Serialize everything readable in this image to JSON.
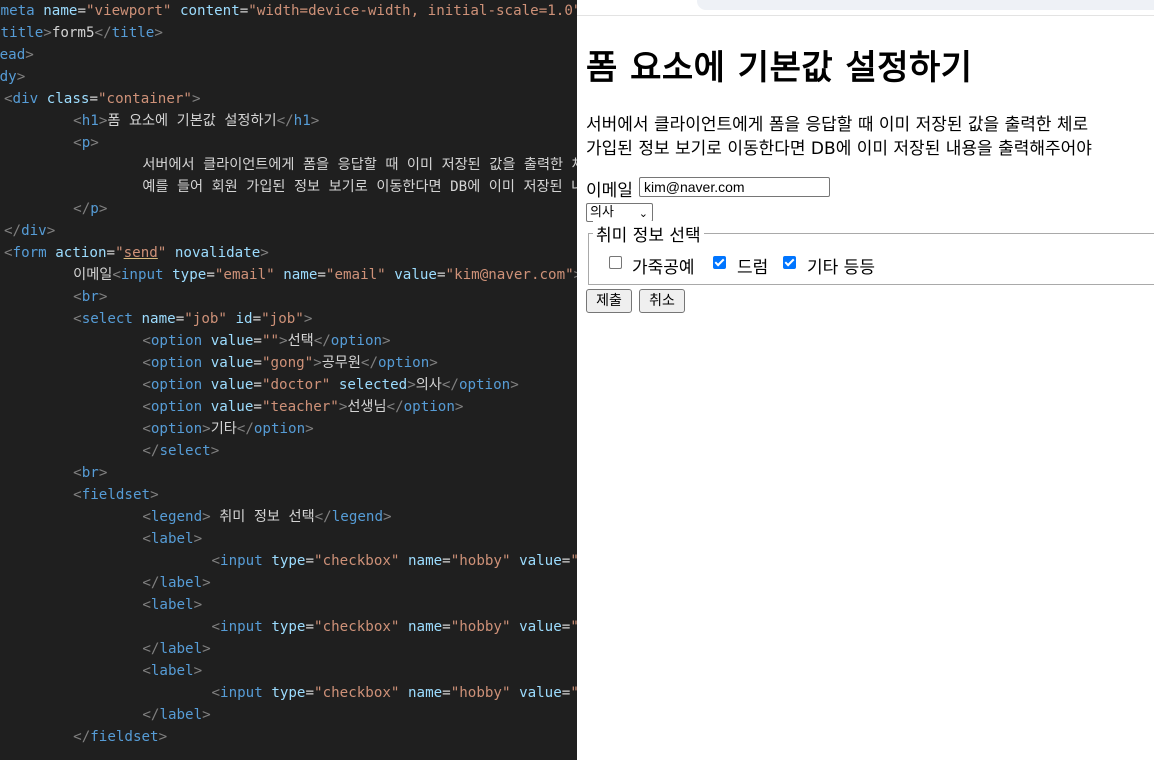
{
  "editor": {
    "lines": [
      [
        [
          "b",
          "<"
        ],
        [
          "t",
          "meta"
        ],
        [
          "x",
          " "
        ],
        [
          "a",
          "name"
        ],
        [
          "x",
          "="
        ],
        [
          "s",
          "\"viewport\""
        ],
        [
          "x",
          " "
        ],
        [
          "a",
          "content"
        ],
        [
          "x",
          "="
        ],
        [
          "s",
          "\"width=device-width, initial-scale=1.0\""
        ],
        [
          "b",
          ">"
        ]
      ],
      [
        [
          "b",
          "<"
        ],
        [
          "t",
          "title"
        ],
        [
          "b",
          ">"
        ],
        [
          "x",
          "form5"
        ],
        [
          "b",
          "</"
        ],
        [
          "t",
          "title"
        ],
        [
          "b",
          ">"
        ]
      ],
      [
        [
          "b",
          "</"
        ],
        [
          "t",
          "head"
        ],
        [
          "b",
          ">"
        ]
      ],
      [
        [
          "b",
          "<"
        ],
        [
          "t",
          "body"
        ],
        [
          "b",
          ">"
        ]
      ],
      [
        [
          "b",
          "<"
        ],
        [
          "t",
          "div"
        ],
        [
          "x",
          " "
        ],
        [
          "a",
          "class"
        ],
        [
          "x",
          "="
        ],
        [
          "s",
          "\"container\""
        ],
        [
          "b",
          ">"
        ]
      ],
      [
        [
          "x",
          "    "
        ],
        [
          "b",
          "<"
        ],
        [
          "t",
          "h1"
        ],
        [
          "b",
          ">"
        ],
        [
          "x",
          "폼 요소에 기본값 설정하기"
        ],
        [
          "b",
          "</"
        ],
        [
          "t",
          "h1"
        ],
        [
          "b",
          ">"
        ]
      ],
      [
        [
          "x",
          "    "
        ],
        [
          "b",
          "<"
        ],
        [
          "t",
          "p"
        ],
        [
          "b",
          ">"
        ]
      ],
      [
        [
          "x",
          "        서버에서 클라이언트에게 폼을 응답할 때 이미 저장된 값을 출력한 체로"
        ]
      ],
      [
        [
          "x",
          "        예를 들어 회원 가입된 정보 보기로 이동한다면 DB에 이미 저장된 내용을"
        ]
      ],
      [
        [
          "x",
          "    "
        ],
        [
          "b",
          "</"
        ],
        [
          "t",
          "p"
        ],
        [
          "b",
          ">"
        ]
      ],
      [
        [
          "b",
          "</"
        ],
        [
          "t",
          "div"
        ],
        [
          "b",
          ">"
        ]
      ],
      [
        [
          "b",
          "<"
        ],
        [
          "t",
          "form"
        ],
        [
          "x",
          " "
        ],
        [
          "a",
          "action"
        ],
        [
          "x",
          "="
        ],
        [
          "s",
          "\""
        ],
        [
          "u",
          "send"
        ],
        [
          "s",
          "\""
        ],
        [
          "x",
          " "
        ],
        [
          "a",
          "novalidate"
        ],
        [
          "b",
          ">"
        ]
      ],
      [
        [
          "x",
          "    이메일"
        ],
        [
          "b",
          "<"
        ],
        [
          "t",
          "input"
        ],
        [
          "x",
          " "
        ],
        [
          "a",
          "type"
        ],
        [
          "x",
          "="
        ],
        [
          "s",
          "\"email\""
        ],
        [
          "x",
          " "
        ],
        [
          "a",
          "name"
        ],
        [
          "x",
          "="
        ],
        [
          "s",
          "\"email\""
        ],
        [
          "x",
          " "
        ],
        [
          "a",
          "value"
        ],
        [
          "x",
          "="
        ],
        [
          "s",
          "\"kim@naver.com\""
        ],
        [
          "b",
          ">"
        ]
      ],
      [
        [
          "x",
          "    "
        ],
        [
          "b",
          "<"
        ],
        [
          "t",
          "br"
        ],
        [
          "b",
          ">"
        ]
      ],
      [
        [
          "x",
          "    "
        ],
        [
          "b",
          "<"
        ],
        [
          "t",
          "select"
        ],
        [
          "x",
          " "
        ],
        [
          "a",
          "name"
        ],
        [
          "x",
          "="
        ],
        [
          "s",
          "\"job\""
        ],
        [
          "x",
          " "
        ],
        [
          "a",
          "id"
        ],
        [
          "x",
          "="
        ],
        [
          "s",
          "\"job\""
        ],
        [
          "b",
          ">"
        ]
      ],
      [
        [
          "x",
          "        "
        ],
        [
          "b",
          "<"
        ],
        [
          "t",
          "option"
        ],
        [
          "x",
          " "
        ],
        [
          "a",
          "value"
        ],
        [
          "x",
          "="
        ],
        [
          "s",
          "\"\""
        ],
        [
          "b",
          ">"
        ],
        [
          "x",
          "선택"
        ],
        [
          "b",
          "</"
        ],
        [
          "t",
          "option"
        ],
        [
          "b",
          ">"
        ]
      ],
      [
        [
          "x",
          "        "
        ],
        [
          "b",
          "<"
        ],
        [
          "t",
          "option"
        ],
        [
          "x",
          " "
        ],
        [
          "a",
          "value"
        ],
        [
          "x",
          "="
        ],
        [
          "s",
          "\"gong\""
        ],
        [
          "b",
          ">"
        ],
        [
          "x",
          "공무원"
        ],
        [
          "b",
          "</"
        ],
        [
          "t",
          "option"
        ],
        [
          "b",
          ">"
        ]
      ],
      [
        [
          "x",
          "        "
        ],
        [
          "b",
          "<"
        ],
        [
          "t",
          "option"
        ],
        [
          "x",
          " "
        ],
        [
          "a",
          "value"
        ],
        [
          "x",
          "="
        ],
        [
          "s",
          "\"doctor\""
        ],
        [
          "x",
          " "
        ],
        [
          "a",
          "selected"
        ],
        [
          "b",
          ">"
        ],
        [
          "x",
          "의사"
        ],
        [
          "b",
          "</"
        ],
        [
          "t",
          "option"
        ],
        [
          "b",
          ">"
        ]
      ],
      [
        [
          "x",
          "        "
        ],
        [
          "b",
          "<"
        ],
        [
          "t",
          "option"
        ],
        [
          "x",
          " "
        ],
        [
          "a",
          "value"
        ],
        [
          "x",
          "="
        ],
        [
          "s",
          "\"teacher\""
        ],
        [
          "b",
          ">"
        ],
        [
          "x",
          "선생님"
        ],
        [
          "b",
          "</"
        ],
        [
          "t",
          "option"
        ],
        [
          "b",
          ">"
        ]
      ],
      [
        [
          "x",
          "        "
        ],
        [
          "b",
          "<"
        ],
        [
          "t",
          "option"
        ],
        [
          "b",
          ">"
        ],
        [
          "x",
          "기타"
        ],
        [
          "b",
          "</"
        ],
        [
          "t",
          "option"
        ],
        [
          "b",
          ">"
        ]
      ],
      [
        [
          "x",
          "        "
        ],
        [
          "b",
          "</"
        ],
        [
          "t",
          "select"
        ],
        [
          "b",
          ">"
        ]
      ],
      [
        [
          "x",
          "    "
        ],
        [
          "b",
          "<"
        ],
        [
          "t",
          "br"
        ],
        [
          "b",
          ">"
        ]
      ],
      [
        [
          "x",
          "    "
        ],
        [
          "b",
          "<"
        ],
        [
          "t",
          "fieldset"
        ],
        [
          "b",
          ">"
        ]
      ],
      [
        [
          "x",
          "        "
        ],
        [
          "b",
          "<"
        ],
        [
          "t",
          "legend"
        ],
        [
          "b",
          ">"
        ],
        [
          "x",
          " 취미 정보 선택"
        ],
        [
          "b",
          "</"
        ],
        [
          "t",
          "legend"
        ],
        [
          "b",
          ">"
        ]
      ],
      [
        [
          "x",
          "        "
        ],
        [
          "b",
          "<"
        ],
        [
          "t",
          "label"
        ],
        [
          "b",
          ">"
        ]
      ],
      [
        [
          "x",
          "            "
        ],
        [
          "b",
          "<"
        ],
        [
          "t",
          "input"
        ],
        [
          "x",
          " "
        ],
        [
          "a",
          "type"
        ],
        [
          "x",
          "="
        ],
        [
          "s",
          "\"checkbox\""
        ],
        [
          "x",
          " "
        ],
        [
          "a",
          "name"
        ],
        [
          "x",
          "="
        ],
        [
          "s",
          "\"hobby\""
        ],
        [
          "x",
          " "
        ],
        [
          "a",
          "value"
        ],
        [
          "x",
          "="
        ],
        [
          "s",
          "\"leather\""
        ],
        [
          "b",
          ">"
        ],
        [
          "x",
          " 가죽공예"
        ]
      ],
      [
        [
          "x",
          "        "
        ],
        [
          "b",
          "</"
        ],
        [
          "t",
          "label"
        ],
        [
          "b",
          ">"
        ]
      ],
      [
        [
          "x",
          "        "
        ],
        [
          "b",
          "<"
        ],
        [
          "t",
          "label"
        ],
        [
          "b",
          ">"
        ]
      ],
      [
        [
          "x",
          "            "
        ],
        [
          "b",
          "<"
        ],
        [
          "t",
          "input"
        ],
        [
          "x",
          " "
        ],
        [
          "a",
          "type"
        ],
        [
          "x",
          "="
        ],
        [
          "s",
          "\"checkbox\""
        ],
        [
          "x",
          " "
        ],
        [
          "a",
          "name"
        ],
        [
          "x",
          "="
        ],
        [
          "s",
          "\"hobby\""
        ],
        [
          "x",
          " "
        ],
        [
          "a",
          "value"
        ],
        [
          "x",
          "="
        ],
        [
          "s",
          "\"drum\""
        ],
        [
          "x",
          " "
        ],
        [
          "a",
          "checked"
        ],
        [
          "b",
          ">"
        ]
      ],
      [
        [
          "x",
          "        "
        ],
        [
          "b",
          "</"
        ],
        [
          "t",
          "label"
        ],
        [
          "b",
          ">"
        ]
      ],
      [
        [
          "x",
          "        "
        ],
        [
          "b",
          "<"
        ],
        [
          "t",
          "label"
        ],
        [
          "b",
          ">"
        ]
      ],
      [
        [
          "x",
          "            "
        ],
        [
          "b",
          "<"
        ],
        [
          "t",
          "input"
        ],
        [
          "x",
          " "
        ],
        [
          "a",
          "type"
        ],
        [
          "x",
          "="
        ],
        [
          "s",
          "\"checkbox\""
        ],
        [
          "x",
          " "
        ],
        [
          "a",
          "name"
        ],
        [
          "x",
          "="
        ],
        [
          "s",
          "\"hobby\""
        ],
        [
          "x",
          " "
        ],
        [
          "a",
          "value"
        ],
        [
          "x",
          "="
        ],
        [
          "s",
          "\"etc\""
        ],
        [
          "x",
          " "
        ],
        [
          "a",
          "checked"
        ],
        [
          "b",
          ">"
        ]
      ],
      [
        [
          "x",
          "        "
        ],
        [
          "b",
          "</"
        ],
        [
          "t",
          "label"
        ],
        [
          "b",
          ">"
        ]
      ],
      [
        [
          "x",
          "    "
        ],
        [
          "b",
          "</"
        ],
        [
          "t",
          "fieldset"
        ],
        [
          "b",
          ">"
        ]
      ]
    ],
    "colors": {
      "background": "#1f1f1f",
      "bracket": "#808080",
      "tag": "#569cd6",
      "attribute": "#9cdcfe",
      "string": "#ce9178",
      "text": "#d4d4d4"
    }
  },
  "browser": {
    "title": "폼 요소에 기본값 설정하기",
    "paragraph_line1": "서버에서 클라이언트에게 폼을 응답할 때 이미 저장된 값을 출력한 체로",
    "paragraph_line2": "가입된 정보 보기로 이동한다면 DB에 이미 저장된 내용을 출력해주어야",
    "email_label": "이메일",
    "email_value": "kim@naver.com",
    "job_selected": "의사",
    "fieldset_legend": "취미 정보 선택",
    "hobbies": [
      {
        "label": "가죽공예",
        "checked": false
      },
      {
        "label": "드럼",
        "checked": true
      },
      {
        "label": "기타 등등",
        "checked": true
      }
    ],
    "submit_label": "제출",
    "reset_label": "취소",
    "colors": {
      "checkbox_checked": "#0075ff",
      "button_bg": "#efefef"
    }
  }
}
